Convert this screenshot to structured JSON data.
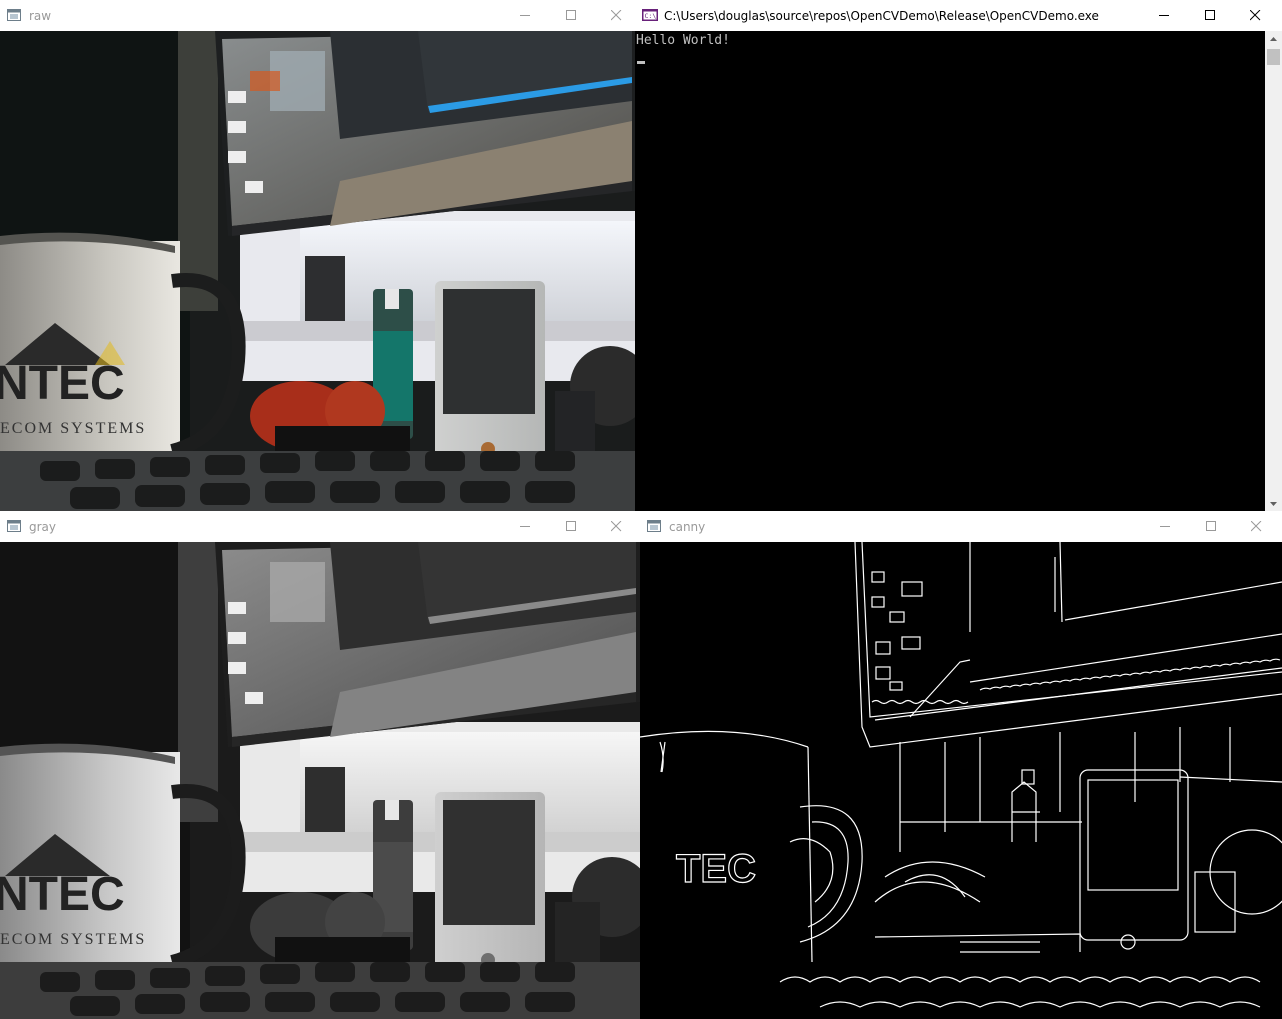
{
  "windows": {
    "raw": {
      "title": "raw"
    },
    "console": {
      "title": "C:\\Users\\douglas\\source\\repos\\OpenCVDemo\\Release\\OpenCVDemo.exe",
      "output": "Hello World!"
    },
    "gray": {
      "title": "gray"
    },
    "canny": {
      "title": "canny"
    }
  },
  "scene": {
    "mug_text_top": "NTEC",
    "mug_text_bottom": "ECOM SYSTEMS",
    "canny_text": "TEC"
  },
  "icons": {
    "opencv_window": "window-icon",
    "console": "console-icon",
    "minimize": "minimize-icon",
    "maximize": "maximize-icon",
    "close": "close-icon"
  },
  "colors": {
    "titlebar_bg": "#ffffff",
    "titlebar_text_inactive": "#999999",
    "console_bg": "#000000",
    "console_text": "#c0c0c0",
    "console_icon": "#68217a"
  }
}
